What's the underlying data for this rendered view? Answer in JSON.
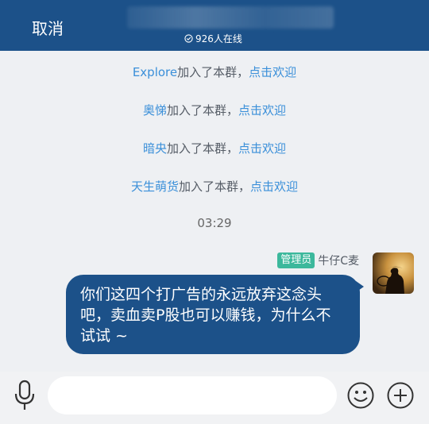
{
  "header": {
    "cancel_label": "取消",
    "online_count": "926人在线"
  },
  "system_messages": [
    {
      "name": "Explore",
      "text": "加入了本群，",
      "action": "点击欢迎"
    },
    {
      "name": "奥悌",
      "text": "加入了本群，",
      "action": "点击欢迎"
    },
    {
      "name": "暗央",
      "text": "加入了本群，",
      "action": "点击欢迎"
    },
    {
      "name": "天生萌货",
      "text": "加入了本群，",
      "action": "点击欢迎"
    }
  ],
  "timestamp": "03:29",
  "message": {
    "badge": "管理员",
    "sender": "牛仔C麦",
    "text": "你们这四个打广告的永远放弃这念头吧，卖血卖P股也可以赚钱，为什么不试试 ~"
  },
  "input": {
    "value": "",
    "placeholder": ""
  },
  "colors": {
    "header": "#1c5189",
    "link": "#3a8fd9",
    "badge": "#3cb89c",
    "bubble": "#1c5189"
  },
  "icons": [
    "check-circle-icon",
    "mic-icon",
    "emoji-icon",
    "plus-icon"
  ]
}
